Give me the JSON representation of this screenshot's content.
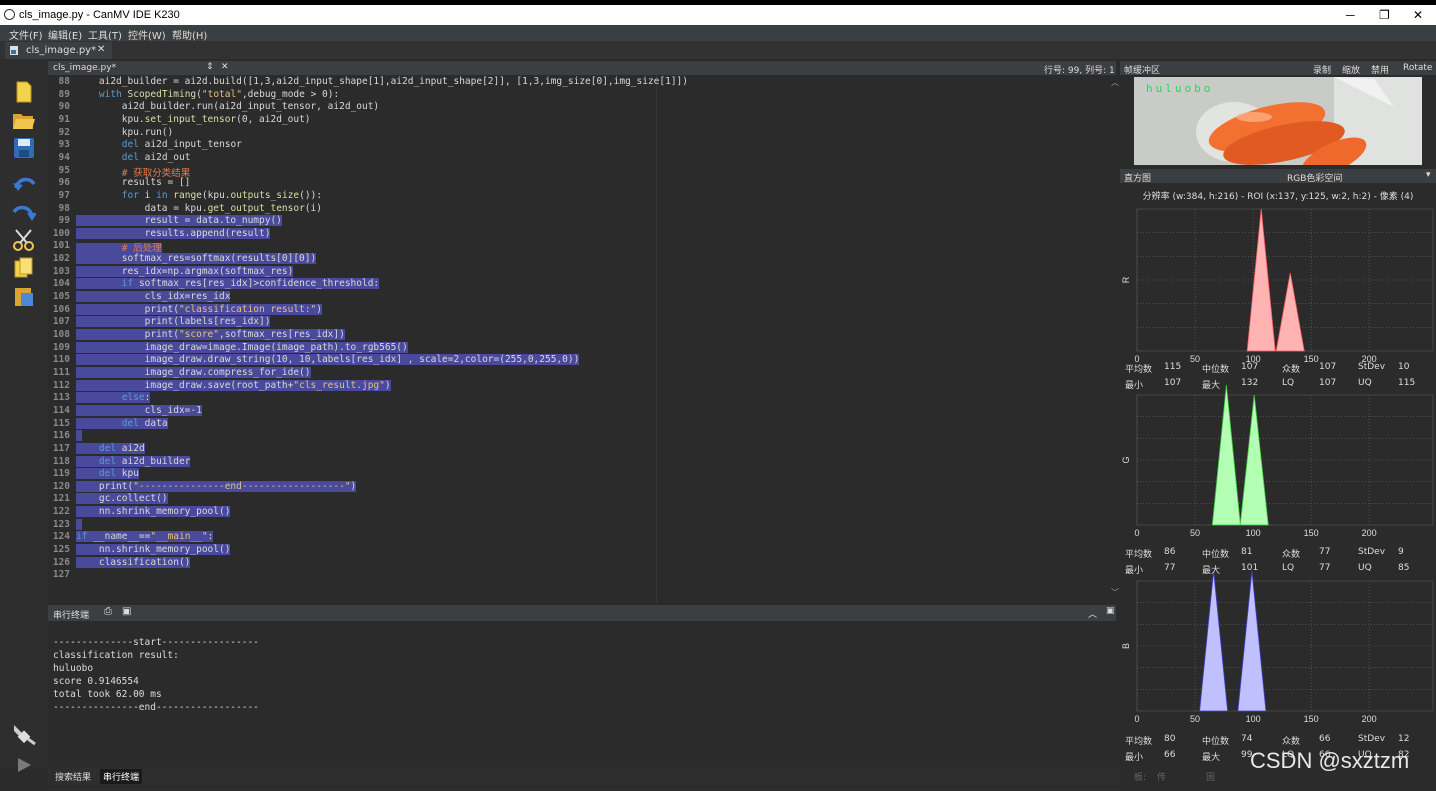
{
  "window": {
    "title": "cls_image.py - CanMV IDE K230",
    "min_glyph": "─",
    "max_glyph": "❐",
    "close_glyph": "✕"
  },
  "menu": [
    "文件(F)",
    "编辑(E)",
    "工具(T)",
    "控件(W)",
    "帮助(H)"
  ],
  "tab": {
    "label": "cls_image.py*",
    "close": "✕"
  },
  "editor": {
    "filename": "cls_image.py*",
    "position": "行号: 99, 列号: 1",
    "lines": [
      {
        "n": "88",
        "t": "    ai2d_builder = ai2d.build([1,3,ai2d_input_shape[1],ai2d_input_shape[2]], [1,3,img_size[0],img_size[1]])"
      },
      {
        "n": "89",
        "t": "    with ScopedTiming(\"total\",debug_mode > 0):"
      },
      {
        "n": "90",
        "t": "        ai2d_builder.run(ai2d_input_tensor, ai2d_out)"
      },
      {
        "n": "91",
        "t": "        kpu.set_input_tensor(0, ai2d_out)"
      },
      {
        "n": "92",
        "t": "        kpu.run()"
      },
      {
        "n": "93",
        "t": "        del ai2d_input_tensor"
      },
      {
        "n": "94",
        "t": "        del ai2d_out"
      },
      {
        "n": "95",
        "t": "        # 获取分类结果"
      },
      {
        "n": "96",
        "t": "        results = []"
      },
      {
        "n": "97",
        "t": "        for i in range(kpu.outputs_size()):"
      },
      {
        "n": "98",
        "t": "            data = kpu.get_output_tensor(i)"
      },
      {
        "n": "99",
        "t": "            result = data.to_numpy()"
      },
      {
        "n": "100",
        "t": "            results.append(result)"
      },
      {
        "n": "101",
        "t": "        # 后处理"
      },
      {
        "n": "102",
        "t": "        softmax_res=softmax(results[0][0])"
      },
      {
        "n": "103",
        "t": "        res_idx=np.argmax(softmax_res)"
      },
      {
        "n": "104",
        "t": "        if softmax_res[res_idx]>confidence_threshold:"
      },
      {
        "n": "105",
        "t": "            cls_idx=res_idx"
      },
      {
        "n": "106",
        "t": "            print(\"classification result:\")"
      },
      {
        "n": "107",
        "t": "            print(labels[res_idx])"
      },
      {
        "n": "108",
        "t": "            print(\"score\",softmax_res[res_idx])"
      },
      {
        "n": "109",
        "t": "            image_draw=image.Image(image_path).to_rgb565()"
      },
      {
        "n": "110",
        "t": "            image_draw.draw_string(10, 10,labels[res_idx] , scale=2,color=(255,0,255,0))"
      },
      {
        "n": "111",
        "t": "            image_draw.compress_for_ide()"
      },
      {
        "n": "112",
        "t": "            image_draw.save(root_path+\"cls_result.jpg\")"
      },
      {
        "n": "113",
        "t": "        else:"
      },
      {
        "n": "114",
        "t": "            cls_idx=-1"
      },
      {
        "n": "115",
        "t": "        del data"
      },
      {
        "n": "116",
        "t": ""
      },
      {
        "n": "117",
        "t": "    del ai2d"
      },
      {
        "n": "118",
        "t": "    del ai2d_builder"
      },
      {
        "n": "119",
        "t": "    del kpu"
      },
      {
        "n": "120",
        "t": "    print(\"---------------end------------------\")"
      },
      {
        "n": "121",
        "t": "    gc.collect()"
      },
      {
        "n": "122",
        "t": "    nn.shrink_memory_pool()"
      },
      {
        "n": "123",
        "t": ""
      },
      {
        "n": "124",
        "t": "if __name__==\"__main__\":"
      },
      {
        "n": "125",
        "t": "    nn.shrink_memory_pool()"
      },
      {
        "n": "126",
        "t": "    classification()"
      },
      {
        "n": "127",
        "t": ""
      }
    ]
  },
  "terminal": {
    "title": "串行终端",
    "lines": [
      "--------------start-----------------",
      "classification result:",
      "huluobo",
      "score 0.9146554",
      "total took 62.00 ms",
      "---------------end------------------"
    ]
  },
  "bottom_tabs": [
    "搜索结果",
    "串行终端"
  ],
  "framebuffer": {
    "title": "帧缓冲区",
    "actions": [
      "录制",
      "缩放",
      "禁用",
      "Rotate"
    ],
    "overlay_text": "huluobo"
  },
  "histogram": {
    "title": "直方图",
    "colorspace": "RGB色彩空间",
    "info": "分辨率 (w:384, h:216) - ROI (x:137, y:125, w:2, h:2) - 像素 (4)",
    "stat_labels": {
      "mean": "平均数",
      "median": "中位数",
      "mode": "众数",
      "stdev": "StDev",
      "min": "最小",
      "max": "最大",
      "lq": "LQ",
      "uq": "UQ"
    },
    "x_ticks": [
      "0",
      "50",
      "100",
      "150",
      "200"
    ],
    "channels": [
      {
        "name": "R",
        "color": "#ffb3b3",
        "stroke": "#ff6060",
        "mean": "115",
        "median": "107",
        "mode": "107",
        "stdev": "10",
        "min": "107",
        "max": "132",
        "lq": "107",
        "uq": "115"
      },
      {
        "name": "G",
        "color": "#b3ffb3",
        "stroke": "#40d040",
        "mean": "86",
        "median": "81",
        "mode": "77",
        "stdev": "9",
        "min": "77",
        "max": "101",
        "lq": "77",
        "uq": "85"
      },
      {
        "name": "B",
        "color": "#c0c0ff",
        "stroke": "#4040d0",
        "mean": "80",
        "median": "74",
        "mode": "66",
        "stdev": "12",
        "min": "66",
        "max": "99",
        "lq": "66",
        "uq": "82"
      }
    ]
  },
  "status": {
    "items": [
      "板:",
      "传感器:",
      "固件版本:"
    ]
  },
  "watermark": "CSDN @sxztzm"
}
